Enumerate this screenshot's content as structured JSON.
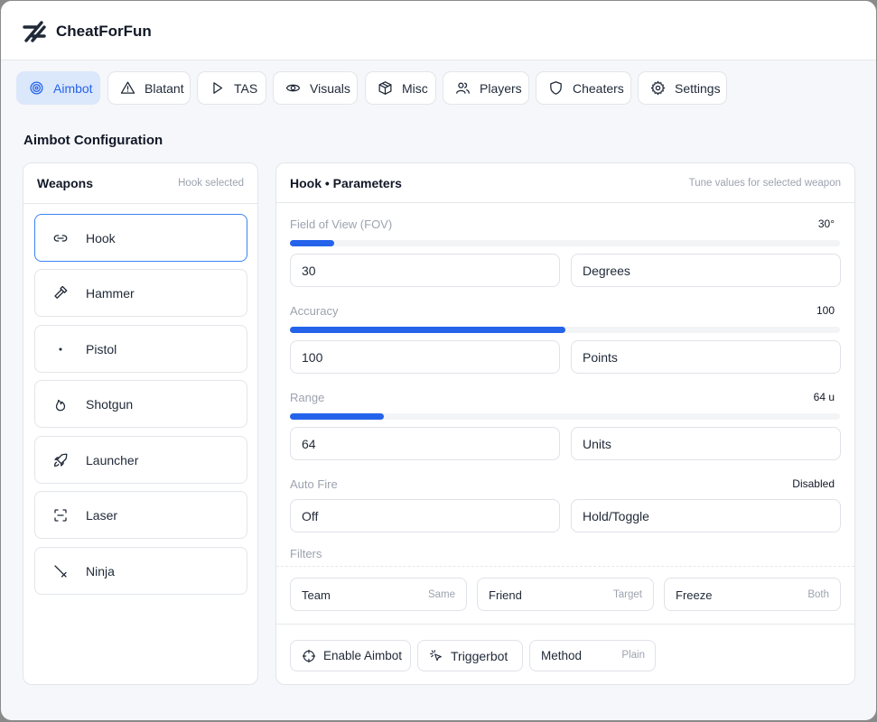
{
  "app": {
    "title": "CheatForFun"
  },
  "tabs": [
    {
      "label": "Aimbot",
      "icon": "target-icon",
      "active": true
    },
    {
      "label": "Blatant",
      "icon": "warning-icon"
    },
    {
      "label": "TAS",
      "icon": "play-icon"
    },
    {
      "label": "Visuals",
      "icon": "eye-icon"
    },
    {
      "label": "Misc",
      "icon": "box-icon"
    },
    {
      "label": "Players",
      "icon": "users-icon"
    },
    {
      "label": "Cheaters",
      "icon": "shield-icon"
    },
    {
      "label": "Settings",
      "icon": "gear-icon"
    }
  ],
  "section_title": "Aimbot Configuration",
  "weapons_panel": {
    "title": "Weapons",
    "hint": "Hook selected",
    "items": [
      {
        "label": "Hook",
        "icon": "link-icon",
        "selected": true
      },
      {
        "label": "Hammer",
        "icon": "hammer-icon"
      },
      {
        "label": "Pistol",
        "icon": "dot-icon"
      },
      {
        "label": "Shotgun",
        "icon": "flame-icon"
      },
      {
        "label": "Launcher",
        "icon": "rocket-icon"
      },
      {
        "label": "Laser",
        "icon": "scan-icon"
      },
      {
        "label": "Ninja",
        "icon": "sword-icon"
      }
    ]
  },
  "params_panel": {
    "title": "Hook • Parameters",
    "hint": "Tune values for selected weapon",
    "params": [
      {
        "label": "Field of View (FOV)",
        "display": "30°",
        "level": 0.08,
        "value": "30",
        "unit": "Degrees"
      },
      {
        "label": "Accuracy",
        "display": "100",
        "level": 0.5,
        "value": "100",
        "unit": "Points"
      },
      {
        "label": "Range",
        "display": "64 u",
        "level": 0.17,
        "value": "64",
        "unit": "Units"
      }
    ],
    "auto_fire": {
      "label": "Auto Fire",
      "display": "Disabled",
      "value": "Off",
      "mode": "Hold/Toggle"
    },
    "filters": {
      "label": "Filters",
      "items": [
        {
          "label": "Team",
          "value": "Same"
        },
        {
          "label": "Friend",
          "value": "Target"
        },
        {
          "label": "Freeze",
          "value": "Both"
        }
      ]
    },
    "actions": {
      "enable_label": "Enable Aimbot",
      "triggerbot_label": "Triggerbot",
      "method_label": "Method",
      "method_value": "Plain"
    }
  },
  "colors": {
    "accent": "#2563eb",
    "active_tab_bg": "#dbe7fa",
    "selected_border": "#3b82f6"
  }
}
